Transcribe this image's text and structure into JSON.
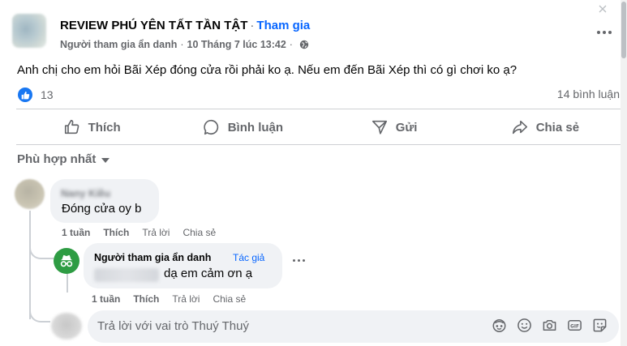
{
  "header": {
    "group_name": "REVIEW PHÚ YÊN TẤT TẦN TẬT",
    "separator": "·",
    "join_label": "Tham gia",
    "author": "Người tham gia ẩn danh",
    "date": "10 Tháng 7 lúc 13:42",
    "date_sep": "·",
    "privacy_icon": "globe-icon",
    "more_icon": "more-horizontal-icon"
  },
  "post": {
    "text": "Anh chị cho em hỏi Bãi Xép đóng cửa rồi phải ko ạ. Nếu em đến Bãi Xép thì có gì chơi ko ạ?",
    "reaction_count": "13",
    "comment_count": "14 bình luận"
  },
  "actions": [
    {
      "label": "Thích",
      "icon": "like-icon"
    },
    {
      "label": "Bình luận",
      "icon": "comment-icon"
    },
    {
      "label": "Gửi",
      "icon": "send-icon"
    },
    {
      "label": "Chia sẻ",
      "icon": "share-icon"
    }
  ],
  "sort": {
    "label": "Phù hợp nhất"
  },
  "comments": [
    {
      "author": "Nany Kiều",
      "text": "Đóng cửa oy b",
      "time": "1 tuần",
      "like": "Thích",
      "reply": "Trả lời",
      "share": "Chia sẻ"
    },
    {
      "author": "Người tham gia ẩn danh",
      "badge": "Tác giả",
      "text": "dạ em cảm ơn ạ",
      "time": "1 tuần",
      "like": "Thích",
      "reply": "Trả lời",
      "share": "Chia sẻ"
    }
  ],
  "composer": {
    "placeholder": "Trả lời với vai trò Thuý Thuý",
    "icons": [
      "avatar-sticker-icon",
      "emoji-icon",
      "camera-icon",
      "gif-icon",
      "sticker-icon"
    ]
  },
  "colors": {
    "accent": "#0866ff",
    "like_blue": "#1877f2",
    "muted_text": "#65676b",
    "bubble_bg": "#f0f2f5",
    "anon_green": "#2e9c43"
  }
}
